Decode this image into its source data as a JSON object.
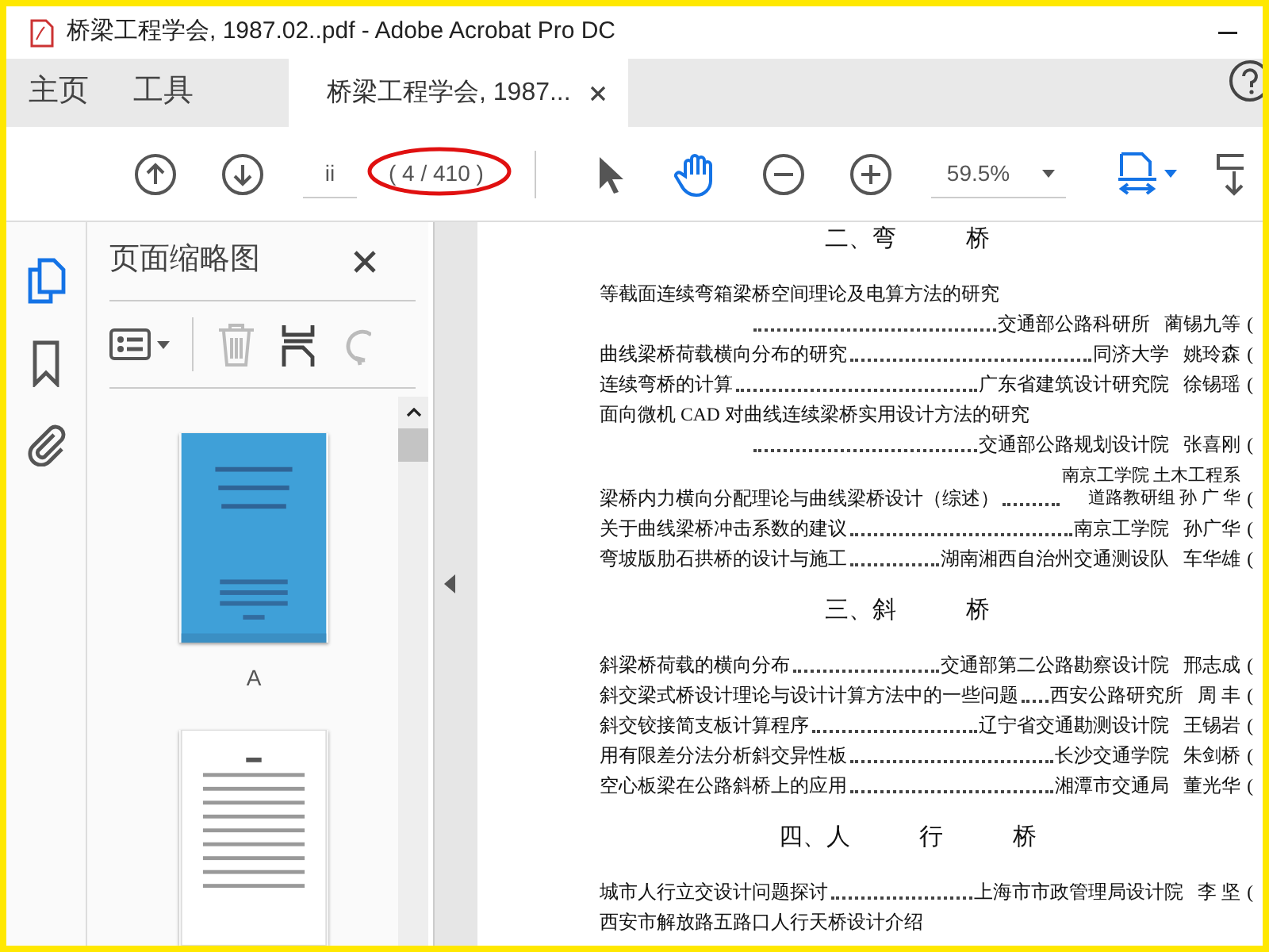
{
  "window": {
    "title": "桥梁工程学会, 1987.02..pdf - Adobe Acrobat Pro DC"
  },
  "tabs": [
    {
      "label": "主页",
      "selected": false,
      "closable": false
    },
    {
      "label": "工具",
      "selected": false,
      "closable": false
    },
    {
      "label": "桥梁工程学会, 1987...",
      "selected": true,
      "closable": true
    }
  ],
  "toolbar": {
    "page_label": "ii",
    "page_count": "( 4 / 410 )",
    "zoom": "59.5%",
    "tools": [
      {
        "kind": "select",
        "selected": false
      },
      {
        "kind": "hand",
        "selected": true
      }
    ]
  },
  "sidebar": {
    "items": [
      {
        "kind": "pages",
        "selected": true
      },
      {
        "kind": "bookmarks",
        "selected": false
      },
      {
        "kind": "attachments",
        "selected": false
      }
    ]
  },
  "thumbnails_panel": {
    "title": "页面缩略图",
    "actions": [
      {
        "kind": "delete",
        "disabled": true
      },
      {
        "kind": "extract",
        "disabled": false
      },
      {
        "kind": "rotate",
        "disabled": true
      }
    ],
    "thumbnails": [
      {
        "kind": "cover",
        "label": "A"
      },
      {
        "kind": "text_page"
      }
    ]
  },
  "document": {
    "sections": [
      {
        "heading": "二、弯 桥",
        "entries": [
          {
            "kind": "wrapped",
            "title": "等截面连续弯箱梁桥空间理论及电算方法的研究",
            "org": "交通部公路科研所",
            "author": "蔺锡九等",
            "page": "("
          },
          {
            "kind": "single",
            "title": "曲线梁桥荷载横向分布的研究",
            "org": "同济大学",
            "author": "姚玲森",
            "page": "("
          },
          {
            "kind": "single",
            "title": "连续弯桥的计算",
            "org": "广东省建筑设计研究院",
            "author": "徐锡瑶",
            "page": "("
          },
          {
            "kind": "wrapped",
            "title": "面向微机 CAD 对曲线连续梁桥实用设计方法的研究",
            "org": "交通部公路规划设计院",
            "author": "张喜刚",
            "page": "("
          },
          {
            "kind": "stacked",
            "title": "梁桥内力横向分配理论与曲线梁桥设计（综述）",
            "org_lines": [
              "南京工学院 土木工程系",
              "道路教研组 孙 广 华"
            ],
            "page": "("
          },
          {
            "kind": "single",
            "title": "关于曲线梁桥冲击系数的建议",
            "org": "南京工学院",
            "author": "孙广华",
            "page": "("
          },
          {
            "kind": "single",
            "title": "弯坡版肋石拱桥的设计与施工",
            "org": "湖南湘西自治州交通测设队",
            "author": "车华雄",
            "page": "("
          }
        ]
      },
      {
        "heading": "三、斜 桥",
        "entries": [
          {
            "kind": "single",
            "title": "斜梁桥荷载的横向分布",
            "org": "交通部第二公路勘察设计院",
            "author": "邢志成",
            "page": "("
          },
          {
            "kind": "single",
            "title": "斜交梁式桥设计理论与设计计算方法中的一些问题",
            "org": "西安公路研究所",
            "author": "周 丰",
            "page": "("
          },
          {
            "kind": "single",
            "title": "斜交铰接简支板计算程序",
            "org": "辽宁省交通勘测设计院",
            "author": "王锡岩",
            "page": "("
          },
          {
            "kind": "single",
            "title": "用有限差分法分析斜交异性板",
            "org": "长沙交通学院",
            "author": "朱剑桥",
            "page": "("
          },
          {
            "kind": "single",
            "title": "空心板梁在公路斜桥上的应用",
            "org": "湘潭市交通局",
            "author": "董光华",
            "page": "("
          }
        ]
      },
      {
        "heading": "四、人 行 桥",
        "entries": [
          {
            "kind": "single",
            "title": "城市人行立交设计问题探讨",
            "org": "上海市市政管理局设计院",
            "author": "李 坚",
            "page": "("
          },
          {
            "kind": "title_only",
            "title": "西安市解放路五路口人行天桥设计介绍"
          }
        ]
      }
    ]
  }
}
